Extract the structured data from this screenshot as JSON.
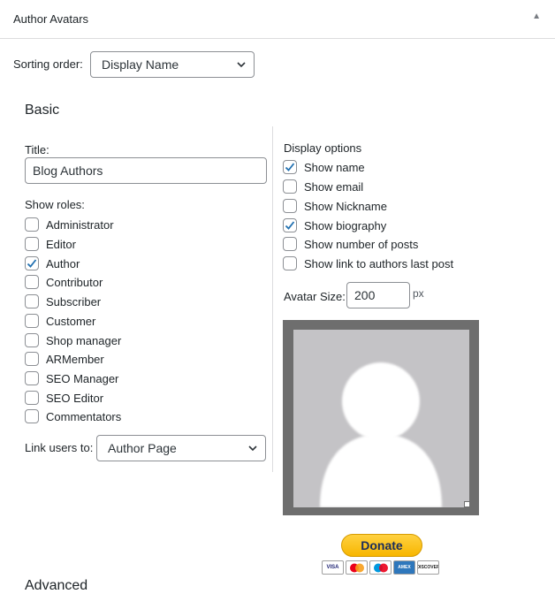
{
  "widget": {
    "title": "Author Avatars"
  },
  "sorting": {
    "label": "Sorting order:",
    "value": "Display Name"
  },
  "sections": {
    "basic": "Basic",
    "advanced": "Advanced"
  },
  "title_field": {
    "label": "Title:",
    "value": "Blog Authors"
  },
  "roles": {
    "label": "Show roles:",
    "items": [
      {
        "label": "Administrator",
        "checked": false
      },
      {
        "label": "Editor",
        "checked": false
      },
      {
        "label": "Author",
        "checked": true
      },
      {
        "label": "Contributor",
        "checked": false
      },
      {
        "label": "Subscriber",
        "checked": false
      },
      {
        "label": "Customer",
        "checked": false
      },
      {
        "label": "Shop manager",
        "checked": false
      },
      {
        "label": "ARMember",
        "checked": false
      },
      {
        "label": "SEO Manager",
        "checked": false
      },
      {
        "label": "SEO Editor",
        "checked": false
      },
      {
        "label": "Commentators",
        "checked": false
      }
    ]
  },
  "link_users": {
    "label": "Link users to:",
    "value": "Author Page"
  },
  "display_options": {
    "label": "Display options",
    "items": [
      {
        "label": "Show name",
        "checked": true
      },
      {
        "label": "Show email",
        "checked": false
      },
      {
        "label": "Show Nickname",
        "checked": false
      },
      {
        "label": "Show biography",
        "checked": true
      },
      {
        "label": "Show number of posts",
        "checked": false
      },
      {
        "label": "Show link to authors last post",
        "checked": false
      }
    ]
  },
  "avatar_size": {
    "label": "Avatar Size:",
    "value": "200",
    "unit": "px"
  },
  "donate": {
    "label": "Donate",
    "cards": [
      "VISA",
      "MC",
      "MAESTRO",
      "AMEX",
      "DISCOVER"
    ]
  },
  "colors": {
    "accent": "#2271b1",
    "donate_bg": "#ffc439"
  }
}
